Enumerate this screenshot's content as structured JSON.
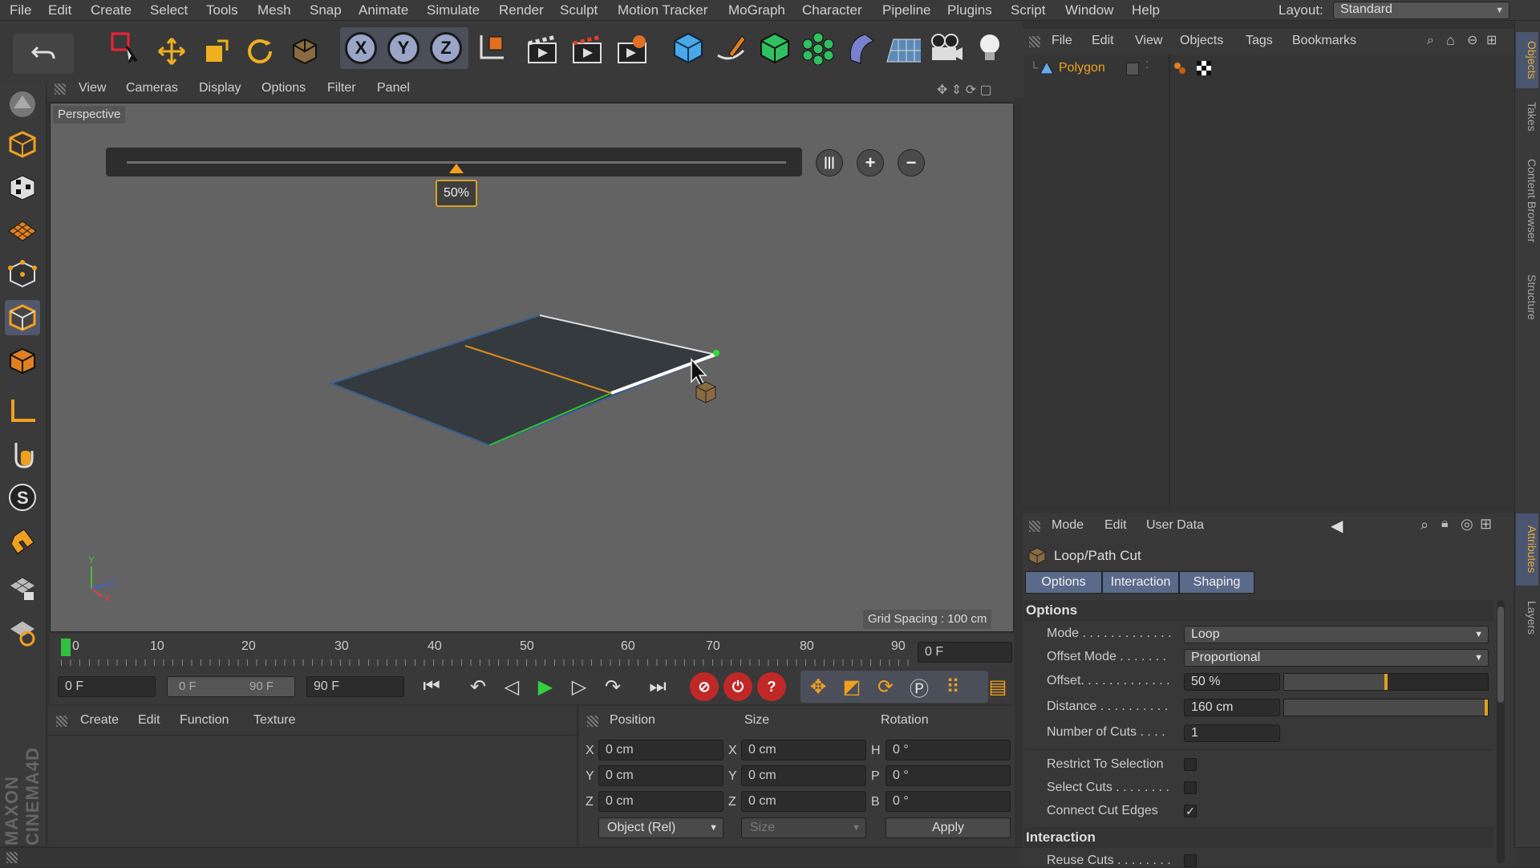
{
  "menu": {
    "items": [
      "File",
      "Edit",
      "Create",
      "Select",
      "Tools",
      "Mesh",
      "Snap",
      "Animate",
      "Simulate",
      "Render",
      "Sculpt",
      "Motion Tracker",
      "MoGraph",
      "Character",
      "Pipeline",
      "Plugins",
      "Script",
      "Window",
      "Help"
    ],
    "layout_label": "Layout:",
    "layout_value": "Standard"
  },
  "toolbar": {
    "axis_x": "X",
    "axis_y": "Y",
    "axis_z": "Z"
  },
  "viewport": {
    "menu": [
      "View",
      "Cameras",
      "Display",
      "Options",
      "Filter",
      "Panel"
    ],
    "label": "Perspective",
    "slider_value": "50%",
    "slider_fraction": 0.5,
    "grid_spacing": "Grid Spacing : 100 cm",
    "axis_y": "Y",
    "axis_z": "Z",
    "axis_x": "X"
  },
  "timeline": {
    "ticks": [
      "0",
      "10",
      "20",
      "30",
      "40",
      "50",
      "60",
      "70",
      "80",
      "90"
    ],
    "current_frame": "0 F",
    "start": "0 F",
    "range_start": "0 F",
    "range_end": "90 F",
    "end": "90 F"
  },
  "material": {
    "menu": [
      "Create",
      "Edit",
      "Function",
      "Texture"
    ]
  },
  "coords": {
    "position": "Position",
    "size": "Size",
    "rotation": "Rotation",
    "rows": [
      {
        "axis": "X",
        "pos": "0 cm",
        "size_axis": "X",
        "size": "0 cm",
        "rot_axis": "H",
        "rot": "0 °"
      },
      {
        "axis": "Y",
        "pos": "0 cm",
        "size_axis": "Y",
        "size": "0 cm",
        "rot_axis": "P",
        "rot": "0 °"
      },
      {
        "axis": "Z",
        "pos": "0 cm",
        "size_axis": "Z",
        "size": "0 cm",
        "rot_axis": "B",
        "rot": "0 °"
      }
    ],
    "mode": "Object (Rel)",
    "size_mode": "Size",
    "apply": "Apply"
  },
  "objects": {
    "menu": [
      "File",
      "Edit",
      "View",
      "Objects",
      "Tags",
      "Bookmarks"
    ],
    "item": "Polygon"
  },
  "attributes": {
    "menu": [
      "Mode",
      "Edit",
      "User Data"
    ],
    "tool": "Loop/Path Cut",
    "tabs": [
      "Options",
      "Interaction",
      "Shaping"
    ],
    "options_header": "Options",
    "mode_label": "Mode . . . . . . . . . . . . .",
    "mode_value": "Loop",
    "offset_mode_label": "Offset Mode . . . . . . .",
    "offset_mode_value": "Proportional",
    "offset_label": "Offset. . . . . . . . . . . . .",
    "offset_value": "50 %",
    "offset_fraction": 0.5,
    "distance_label": "Distance . . . . . . . . . .",
    "distance_value": "160 cm",
    "distance_fraction": 1.0,
    "cuts_label": "Number of Cuts . . . .",
    "cuts_value": "1",
    "restrict_label": "Restrict To Selection",
    "restrict": false,
    "select_label": "Select Cuts . . . . . . . .",
    "select": false,
    "connect_label": "Connect Cut Edges",
    "connect": true,
    "interaction_header": "Interaction",
    "reuse_label": "Reuse Cuts . . . . . . . ."
  },
  "side_tabs": [
    "Objects",
    "Takes",
    "Content Browser",
    "Structure",
    "Attributes",
    "Layers"
  ],
  "brand": "MAXON CINEMA4D"
}
